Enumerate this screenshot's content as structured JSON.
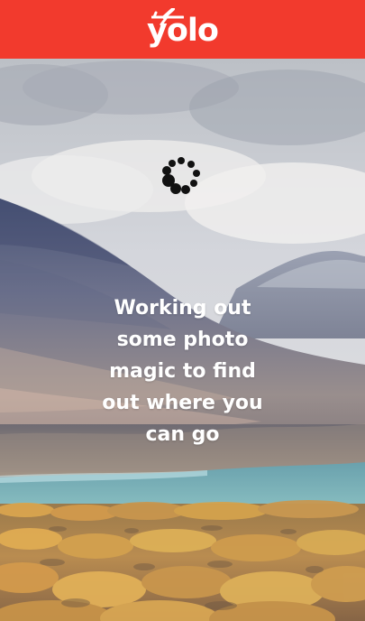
{
  "header": {
    "logo_text": "yolo",
    "logo_icon": "airplane-icon",
    "background_color": "#f23a2d"
  },
  "main": {
    "spinner_icon": "loading-spinner-icon",
    "message_lines": [
      "Working out",
      "some photo",
      "magic to find",
      "out where you",
      "can go"
    ]
  }
}
